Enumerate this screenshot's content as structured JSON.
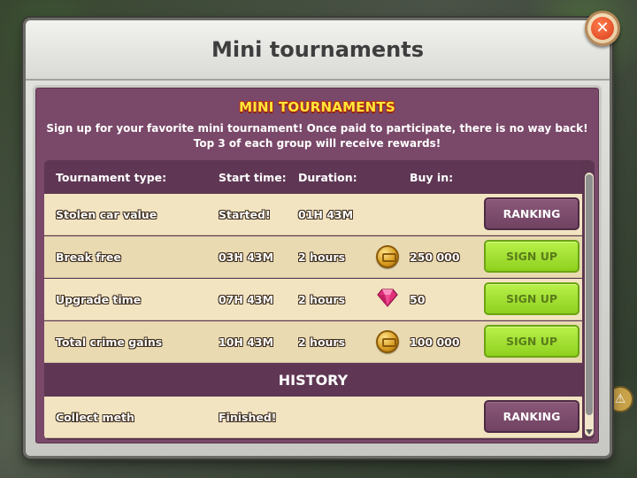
{
  "window": {
    "title": "Mini tournaments",
    "close_icon": "close-icon",
    "close_glyph": "✕"
  },
  "panel": {
    "heading": "MINI TOURNAMENTS",
    "description": "Sign up for your favorite mini tournament! Once paid to participate, there is no way back! Top 3 of each group will receive rewards!"
  },
  "table": {
    "headers": {
      "type": "Tournament type:",
      "start": "Start time:",
      "duration": "Duration:",
      "buy_in": "Buy in:"
    },
    "rows": [
      {
        "type": "Stolen car value",
        "start": "Started!",
        "duration": "01H 43M",
        "currency_icon": "",
        "buy_in": "",
        "action": "RANKING"
      },
      {
        "type": "Break free",
        "start": "03H 43M",
        "duration": "2 hours",
        "currency_icon": "cash-coin-icon",
        "buy_in": "250 000",
        "action": "SIGN UP"
      },
      {
        "type": "Upgrade time",
        "start": "07H 43M",
        "duration": "2 hours",
        "currency_icon": "gem-icon",
        "buy_in": "50",
        "action": "SIGN UP"
      },
      {
        "type": "Total crime gains",
        "start": "10H 43M",
        "duration": "2 hours",
        "currency_icon": "cash-coin-icon",
        "buy_in": "100 000",
        "action": "SIGN UP"
      }
    ],
    "history_heading": "HISTORY",
    "history_rows": [
      {
        "type": "Collect meth",
        "start": "Finished!",
        "action": "RANKING"
      }
    ]
  },
  "colors": {
    "panel_bg": "#7a4869",
    "row_bg": "#f2e4c1",
    "signup_green": "#a6e234",
    "ranking_purple": "#7d4c6d",
    "heading_yellow": "#ffe63b"
  },
  "background": {
    "badge_glyph": "⚠"
  }
}
